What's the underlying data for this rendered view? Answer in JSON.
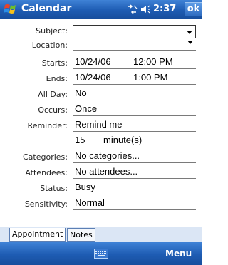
{
  "titlebar": {
    "app_title": "Calendar",
    "clock": "2:37",
    "ok_label": "ok"
  },
  "form": {
    "subject": {
      "label": "Subject:",
      "value": ""
    },
    "location": {
      "label": "Location:",
      "value": ""
    },
    "starts": {
      "label": "Starts:",
      "date": "10/24/06",
      "time": "12:00 PM"
    },
    "ends": {
      "label": "Ends:",
      "date": "10/24/06",
      "time": "1:00 PM"
    },
    "all_day": {
      "label": "All Day:",
      "value": "No"
    },
    "occurs": {
      "label": "Occurs:",
      "value": "Once"
    },
    "reminder": {
      "label": "Reminder:",
      "value": "Remind me",
      "amount": "15",
      "unit": "minute(s)"
    },
    "categories": {
      "label": "Categories:",
      "value": "No categories..."
    },
    "attendees": {
      "label": "Attendees:",
      "value": "No attendees..."
    },
    "status": {
      "label": "Status:",
      "value": "Busy"
    },
    "sensitivity": {
      "label": "Sensitivity:",
      "value": "Normal"
    }
  },
  "tabs": [
    {
      "label": "Appointment"
    },
    {
      "label": "Notes"
    }
  ],
  "menubar": {
    "menu_label": "Menu",
    "keyboard_icon": "keyboard-icon"
  },
  "colors": {
    "bar_blue": "#1e5cb3",
    "tab_area": "#dbe6f5"
  }
}
